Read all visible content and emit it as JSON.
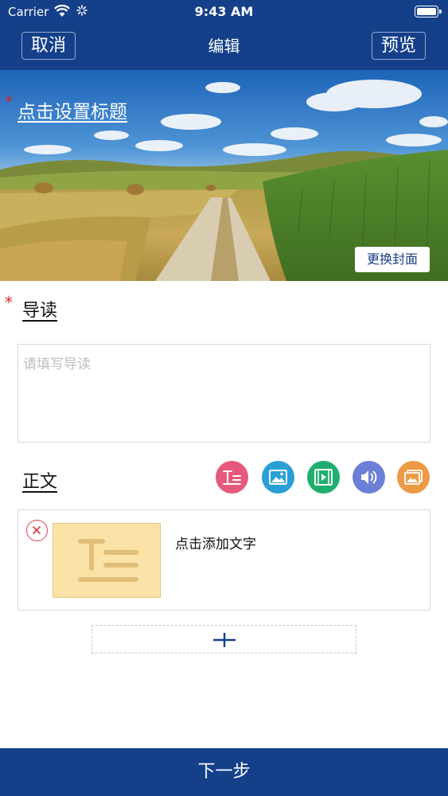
{
  "status_bar": {
    "carrier": "Carrier",
    "time": "9:43 AM"
  },
  "nav": {
    "cancel_label": "取消",
    "title": "编辑",
    "preview_label": "预览"
  },
  "cover": {
    "required_mark": "*",
    "title_placeholder": "点击设置标题",
    "change_cover_label": "更换封面"
  },
  "intro": {
    "required_mark": "*",
    "label": "导读",
    "placeholder": "请填写导读"
  },
  "body": {
    "label": "正文",
    "tools": [
      {
        "icon": "text-icon",
        "color": "#e5597c"
      },
      {
        "icon": "image-icon",
        "color": "#2a9fd6"
      },
      {
        "icon": "video-icon",
        "color": "#1fae6f"
      },
      {
        "icon": "audio-icon",
        "color": "#6b7fd6"
      },
      {
        "icon": "gallery-icon",
        "color": "#eb9a45"
      }
    ],
    "blocks": [
      {
        "text": "点击添加文字"
      }
    ]
  },
  "footer": {
    "next_label": "下一步"
  },
  "colors": {
    "primary": "#14408a",
    "required": "#d6262b"
  }
}
